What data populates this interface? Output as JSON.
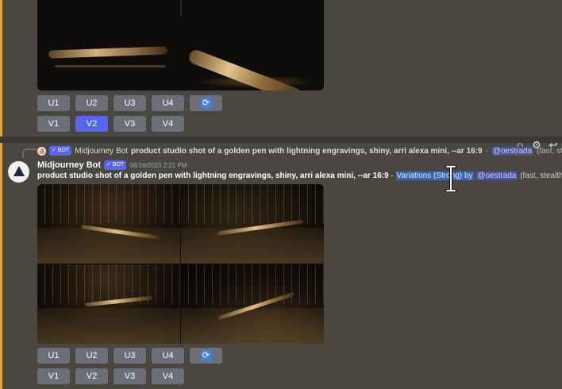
{
  "first_message": {
    "upscale_buttons": [
      "U1",
      "U2",
      "U3",
      "U4"
    ],
    "variation_buttons": [
      "V1",
      "V2",
      "V3",
      "V4"
    ],
    "active_button": "V2",
    "refresh_icon": "refresh-icon"
  },
  "reply": {
    "bot_badge": "BOT",
    "author": "Midjourney Bot",
    "prompt": "product studio shot of a golden pen with lightning engravings, shiny, arri alexa mini, --ar 16:9",
    "sep": " - ",
    "mention": "@oestrada",
    "status": "(fast, stealth)"
  },
  "message": {
    "username": "Midjourney Bot",
    "bot_badge": "BOT",
    "timestamp": "08/16/2023 2:21 PM",
    "prompt": "product studio shot of a golden pen with lightning engravings, shiny, arri alexa mini, --ar 16:9",
    "sep": " - ",
    "variation_label": "Variations (Strong) by",
    "mention": "@oestrada",
    "status": "(fast, stealth)",
    "upscale_buttons": [
      "U1",
      "U2",
      "U3",
      "U4"
    ],
    "variation_buttons": [
      "V1",
      "V2",
      "V3",
      "V4"
    ]
  },
  "colors": {
    "background": "#4a4741",
    "button": "#6c6f78",
    "button_active": "#5865f2",
    "mention": "#4b5595",
    "selection": "#3f67a8"
  }
}
